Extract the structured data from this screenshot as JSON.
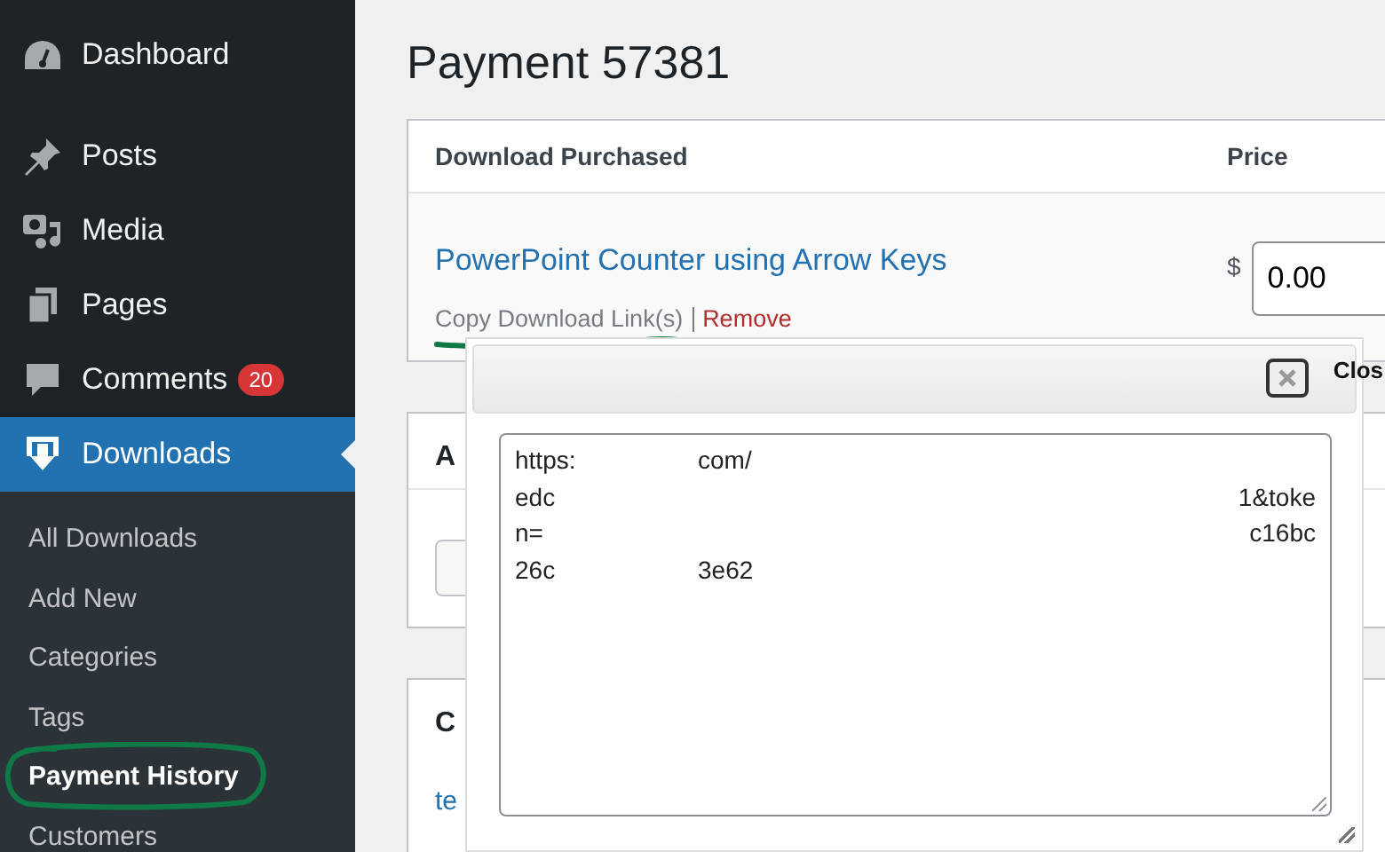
{
  "sidebar": {
    "items": [
      {
        "label": "Dashboard",
        "selected": false
      },
      {
        "label": "Posts",
        "selected": false
      },
      {
        "label": "Media",
        "selected": false
      },
      {
        "label": "Pages",
        "selected": false
      },
      {
        "label": "Comments",
        "badge": "20",
        "selected": false
      },
      {
        "label": "Downloads",
        "selected": true
      }
    ],
    "submenu": [
      {
        "label": "All Downloads",
        "selected": false
      },
      {
        "label": "Add New",
        "selected": false
      },
      {
        "label": "Categories",
        "selected": false
      },
      {
        "label": "Tags",
        "selected": false
      },
      {
        "label": "Payment History",
        "selected": true
      },
      {
        "label": "Customers",
        "selected": false
      }
    ]
  },
  "page_title": "Payment 57381",
  "downloads_card": {
    "columns": [
      "Download Purchased",
      "Price"
    ],
    "item": {
      "name": "PowerPoint Counter using Arrow Keys",
      "currency": "$",
      "price": "0.00",
      "actions": [
        "Copy Download Link(s)",
        "Remove"
      ]
    }
  },
  "second_card": {
    "heading": "A"
  },
  "customer_card": {
    "heading": "C",
    "link": "te"
  },
  "popup": {
    "close_label": "Clos",
    "lines": [
      {
        "start": "https:",
        "middle": "com/"
      },
      {
        "start": "edc",
        "end": "1&toke"
      },
      {
        "start": "n=",
        "end": "c16bc"
      },
      {
        "start": "26c",
        "middle": "3e62"
      }
    ]
  }
}
